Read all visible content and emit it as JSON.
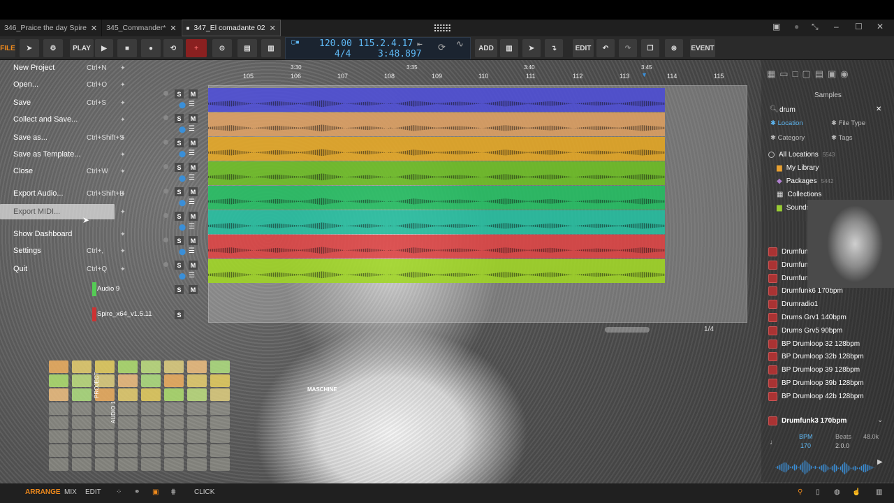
{
  "tabs": [
    {
      "label": "346_Praice the day Spire"
    },
    {
      "label": "345_Commander*"
    },
    {
      "label": "347_El comadante 02",
      "active": true
    }
  ],
  "toolbar": {
    "file": "FILE",
    "play_label": "PLAY",
    "tempo": "120.00",
    "position": "115.2.4.17",
    "signature": "4/4",
    "time": "3:48.897",
    "add": "ADD",
    "edit": "EDIT",
    "event": "EVENT"
  },
  "file_menu": [
    {
      "label": "New Project",
      "shortcut": "Ctrl+N"
    },
    {
      "label": "Open...",
      "shortcut": "Ctrl+O"
    },
    {
      "label": "Save",
      "shortcut": "Ctrl+S"
    },
    {
      "label": "Collect and Save...",
      "shortcut": ""
    },
    {
      "label": "Save as...",
      "shortcut": "Ctrl+Shift+S"
    },
    {
      "label": "Save as Template...",
      "shortcut": ""
    },
    {
      "label": "Close",
      "shortcut": "Ctrl+W"
    },
    {
      "label": "Export Audio...",
      "shortcut": "Ctrl+Shift+B"
    },
    {
      "label": "Export MIDI...",
      "shortcut": ""
    },
    {
      "label": "Show Dashboard",
      "shortcut": ""
    },
    {
      "label": "Settings",
      "shortcut": "Ctrl+,"
    },
    {
      "label": "Quit",
      "shortcut": "Ctrl+Q"
    }
  ],
  "ruler": {
    "bars": [
      "105",
      "106",
      "107",
      "108",
      "109",
      "110",
      "111",
      "112",
      "113",
      "114",
      "115"
    ],
    "times": [
      "3:30",
      "3:35",
      "3:40",
      "3:45"
    ]
  },
  "tracks": [
    {
      "solo": "S",
      "mute": "M",
      "color": "#4a4ad8"
    },
    {
      "solo": "S",
      "mute": "M",
      "color": "#e0a060"
    },
    {
      "solo": "S",
      "mute": "M",
      "color": "#e8a820"
    },
    {
      "solo": "S",
      "mute": "M",
      "color": "#6cc020"
    },
    {
      "solo": "S",
      "mute": "M",
      "color": "#20c060"
    },
    {
      "solo": "S",
      "mute": "M",
      "color": "#20c0a0"
    },
    {
      "solo": "S",
      "mute": "M",
      "color": "#e04040"
    },
    {
      "solo": "S",
      "mute": "M",
      "color": "#a0d820"
    }
  ],
  "extra_tracks": [
    {
      "name": "Audio 9",
      "solo": "S",
      "mute": "M"
    },
    {
      "name": "Spire_x64_v1.5.11",
      "solo": "S"
    }
  ],
  "arranger_footer": {
    "zoom": "1/4"
  },
  "browser": {
    "title": "Samples",
    "search": "drum",
    "filters": {
      "location": "Location",
      "file_type": "File Type",
      "category": "Category",
      "tags": "Tags"
    },
    "locations": [
      {
        "label": "All Locations",
        "count": "5543"
      },
      {
        "label": "My Library",
        "count": ""
      },
      {
        "label": "Packages",
        "count": "5442"
      },
      {
        "label": "Collections",
        "count": ""
      },
      {
        "label": "Sounds",
        "count": ""
      }
    ],
    "results": [
      "Drumfunk",
      "Drumfunk",
      "Drumfunk",
      "Drumfunk6 170bpm",
      "Drumradio1",
      "Drums Grv1 140bpm",
      "Drums Grv5 90bpm",
      "BP Drumloop 32 128bpm",
      "BP Drumloop 32b 128bpm",
      "BP Drumloop 39 128bpm",
      "BP Drumloop 39b 128bpm",
      "BP Drumloop 42b 128bpm"
    ],
    "selected": "Drumfunk3 170bpm",
    "preview": {
      "bpm_label": "BPM",
      "bpm": "170",
      "beats_label": "Beats",
      "beats": "2.0.0",
      "rate": "48.0k"
    }
  },
  "pad_controller": {
    "labels": [
      "PROJECT",
      "AUDIO 1"
    ],
    "brand": "MASCHINE"
  },
  "bottom_bar": {
    "arrange": "ARRANGE",
    "mix": "MIX",
    "edit": "EDIT",
    "click": "CLICK"
  },
  "colors": {
    "accent": "#f08a1c",
    "lcd_text": "#5fb9f5",
    "selection_blue": "#3a8fd8"
  }
}
